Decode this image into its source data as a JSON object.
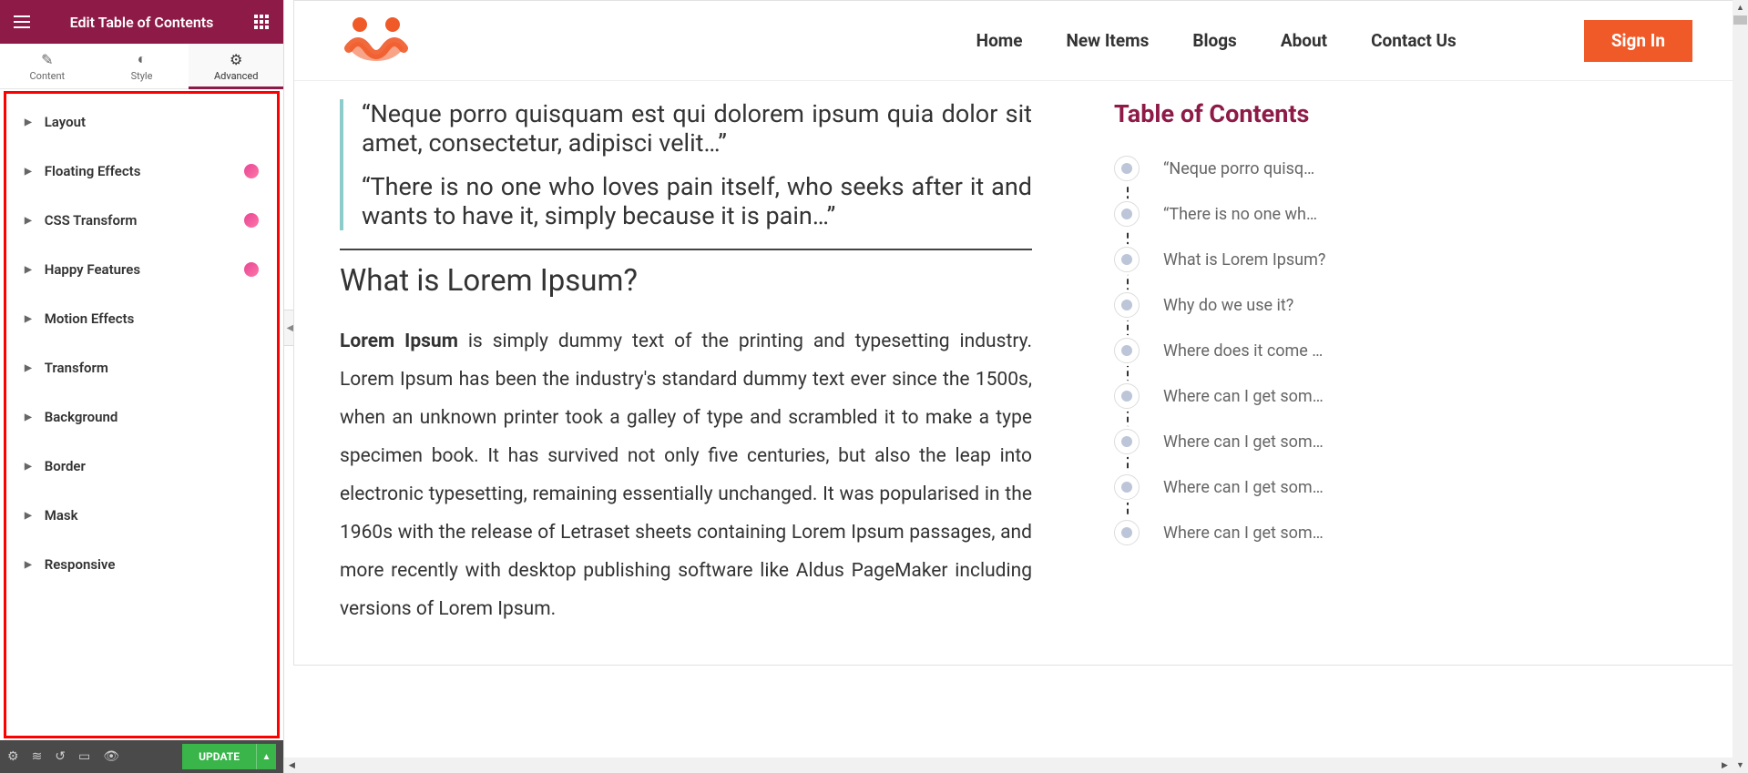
{
  "leftPanel": {
    "title": "Edit Table of Contents",
    "tabs": {
      "content": "Content",
      "style": "Style",
      "advanced": "Advanced"
    },
    "sections": [
      {
        "label": "Layout",
        "badge": false
      },
      {
        "label": "Floating Effects",
        "badge": true
      },
      {
        "label": "CSS Transform",
        "badge": true
      },
      {
        "label": "Happy Features",
        "badge": true
      },
      {
        "label": "Motion Effects",
        "badge": false
      },
      {
        "label": "Transform",
        "badge": false
      },
      {
        "label": "Background",
        "badge": false
      },
      {
        "label": "Border",
        "badge": false
      },
      {
        "label": "Mask",
        "badge": false
      },
      {
        "label": "Responsive",
        "badge": false
      }
    ],
    "updateBtn": "UPDATE"
  },
  "site": {
    "nav": {
      "home": "Home",
      "newItems": "New Items",
      "blogs": "Blogs",
      "about": "About",
      "contact": "Contact Us"
    },
    "signIn": "Sign In"
  },
  "article": {
    "quote1": "“Neque porro quisquam est qui dolorem ipsum quia dolor sit amet, consectetur, adipisci velit…”",
    "quote2": "“There is no one who loves pain itself, who seeks after it and wants to have it, simply because it is pain…”",
    "h2": "What is Lorem Ipsum?",
    "bodyBold": "Lorem Ipsum",
    "bodyRest": " is simply dummy text of the printing and typesetting industry. Lorem Ipsum has been the industry's standard dummy text ever since the 1500s, when an unknown printer took a galley of type and scrambled it to make a type specimen book. It has survived not only five centuries, but also the leap into electronic typesetting, remaining essentially unchanged. It was popularised in the 1960s with the release of Letraset sheets containing Lorem Ipsum passages, and more recently with desktop publishing software like Aldus PageMaker including versions of Lorem Ipsum."
  },
  "toc": {
    "title": "Table of Contents",
    "items": [
      "“Neque porro quisq…",
      "“There is no one wh…",
      "What is Lorem Ipsum?",
      "Why do we use it?",
      "Where does it come …",
      "Where can I get som…",
      "Where can I get som…",
      "Where can I get som…",
      "Where can I get som…"
    ]
  }
}
